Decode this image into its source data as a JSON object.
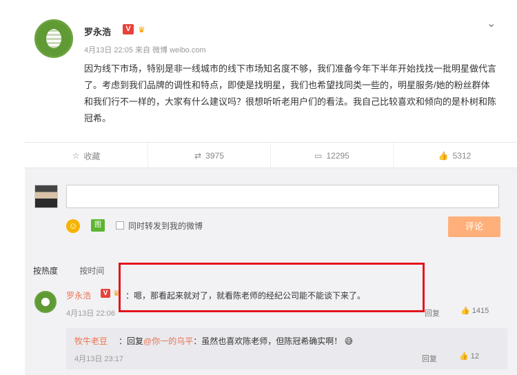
{
  "post": {
    "author": "罗永浩",
    "v_badge": "V",
    "crown_icon": "crown-icon",
    "meta": "4月13日 22:05 来自 微博 weibo.com",
    "text": "因为线下市场，特别是非一线城市的线下市场知名度不够，我们准备今年下半年开始找找一批明星做代言了。考虑到我们品牌的调性和特点，即使是找明星，我们也希望找同类一些的，明星服务/她的粉丝群体和我们行不一样的，大家有什么建议吗？很想听听老用户们的看法。我自己比较喜欢和倾向的是朴树和陈冠希。"
  },
  "actions": {
    "favorite_label": "收藏",
    "repost_count": "3975",
    "comment_count": "12295",
    "like_count": "5312"
  },
  "composer": {
    "placeholder": "",
    "repost_option": "同时转发到我的微博",
    "submit_label": "评论",
    "image_label": "图"
  },
  "sort_tabs": {
    "hot": "按热度",
    "time": "按时间"
  },
  "comment": {
    "author": "罗永浩",
    "v_badge": "V",
    "text": "：嗯，那看起来就对了，就看陈老师的经纪公司能不能谈下来了。",
    "time": "4月13日 22:06",
    "reply_label": "回复",
    "like_count": "1415"
  },
  "reply": {
    "author": "牧牛老豆",
    "prefix": "：回复",
    "mention": "@你一的乌平",
    "text": "：虽然也喜欢陈老师，但陈冠希确实啊！",
    "time": "4月13日 23:17",
    "reply_label": "回复",
    "like_count": "12"
  },
  "colors": {
    "highlight": "#e3141b",
    "username": "#eb7350",
    "submit": "#ffb07a"
  }
}
